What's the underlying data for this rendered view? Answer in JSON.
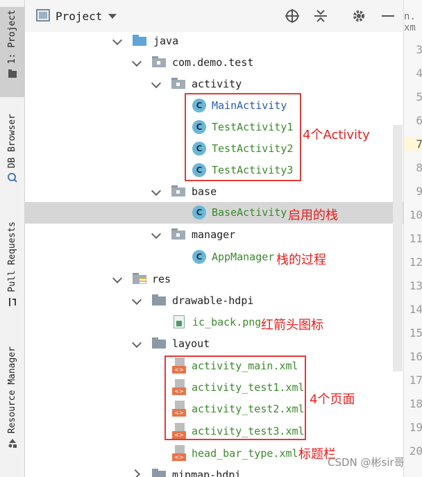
{
  "sidebar": {
    "tabs": [
      {
        "label": "1: Project",
        "icon": "folder-icon",
        "active": true
      },
      {
        "label": "DB Browser",
        "icon": "database-icon",
        "active": false
      },
      {
        "label": "Pull Requests",
        "icon": "pull-request-icon",
        "active": false
      },
      {
        "label": "Resource Manager",
        "icon": "resource-icon",
        "active": false
      }
    ]
  },
  "toolbar": {
    "title": "Project",
    "icons": [
      "locate-icon",
      "collapse-all-icon",
      "gear-icon",
      "minimize-icon"
    ]
  },
  "tree": {
    "rows": [
      {
        "label": "java",
        "kind": "java-folder",
        "expanded": true
      },
      {
        "label": "com.demo.test",
        "kind": "package",
        "expanded": true
      },
      {
        "label": "activity",
        "kind": "package",
        "expanded": true
      },
      {
        "label": "MainActivity",
        "kind": "class"
      },
      {
        "label": "TestActivity1",
        "kind": "class"
      },
      {
        "label": "TestActivity2",
        "kind": "class"
      },
      {
        "label": "TestActivity3",
        "kind": "class"
      },
      {
        "label": "base",
        "kind": "package",
        "expanded": true
      },
      {
        "label": "BaseActivity",
        "kind": "class",
        "selected": true
      },
      {
        "label": "manager",
        "kind": "package",
        "expanded": true
      },
      {
        "label": "AppManager",
        "kind": "class"
      },
      {
        "label": "res",
        "kind": "res-folder",
        "expanded": true
      },
      {
        "label": "drawable-hdpi",
        "kind": "folder",
        "expanded": true
      },
      {
        "label": "ic_back.png",
        "kind": "image"
      },
      {
        "label": "layout",
        "kind": "folder",
        "expanded": true
      },
      {
        "label": "activity_main.xml",
        "kind": "xml"
      },
      {
        "label": "activity_test1.xml",
        "kind": "xml"
      },
      {
        "label": "activity_test2.xml",
        "kind": "xml"
      },
      {
        "label": "activity_test3.xml",
        "kind": "xml"
      },
      {
        "label": "head_bar_type.xml",
        "kind": "xml"
      },
      {
        "label": "mipmap-hdpi",
        "kind": "folder",
        "expanded": false
      }
    ]
  },
  "annotations": {
    "activities": "4个Activity",
    "base": "启用的栈",
    "manager": "栈的过程",
    "icback": "红箭头图标",
    "pages": "4个页面",
    "headbar": "标题栏"
  },
  "editor": {
    "tab_fragment": "n. xm",
    "line_numbers": [
      "3",
      "4",
      "5",
      "6",
      "7",
      "8",
      "9",
      "10",
      "11",
      "12",
      "13",
      "14",
      "15",
      "16",
      "17",
      "18",
      "19",
      "20"
    ],
    "current_line": "7"
  },
  "watermark": "CSDN @彬sir哥",
  "colors": {
    "annotation_red": "#ee1c1c",
    "class_green": "#3b8a2c",
    "class_blue": "#2a5db0",
    "selection": "#d6d6d6"
  }
}
